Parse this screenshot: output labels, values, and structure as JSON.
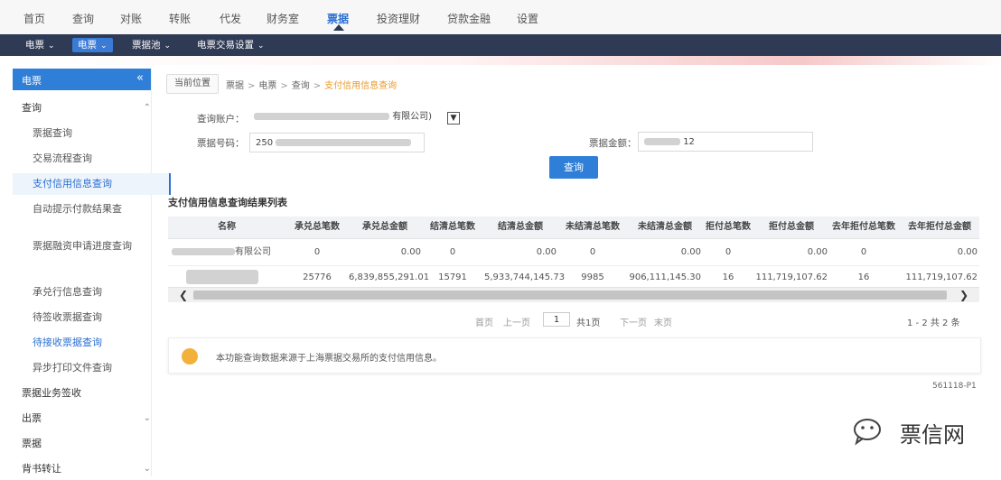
{
  "topnav": {
    "items": [
      "首页",
      "查询",
      "对账",
      "转账",
      "代发",
      "财务室",
      "票据",
      "投资理财",
      "贷款金融",
      "设置"
    ],
    "active_index": 6
  },
  "subnav": {
    "items": [
      "电票",
      "电票",
      "票据池",
      "电票交易设置"
    ],
    "active_index": 1
  },
  "sidebar": {
    "header": "电票",
    "collapse_icon": "«",
    "rows": [
      {
        "label": "查询",
        "type": "group",
        "arrow": "up"
      },
      {
        "label": "票据查询",
        "type": "child"
      },
      {
        "label": "交易流程查询",
        "type": "child"
      },
      {
        "label": "支付信用信息查询",
        "type": "child",
        "active": true
      },
      {
        "label": "自动提示付款结果查",
        "type": "child"
      },
      {
        "label": "票据融资申请进度查询",
        "type": "child"
      },
      {
        "label": "承兑行信息查询",
        "type": "child"
      },
      {
        "label": "待签收票据查询",
        "type": "child"
      },
      {
        "label": "待接收票据查询",
        "type": "child"
      },
      {
        "label": "异步打印文件查询",
        "type": "child"
      },
      {
        "label": "票据业务签收",
        "type": "group"
      },
      {
        "label": "出票",
        "type": "group",
        "arrow": "down"
      },
      {
        "label": "票据",
        "type": "group"
      },
      {
        "label": "背书转让",
        "type": "group",
        "arrow": "down"
      }
    ]
  },
  "breadcrumb": {
    "tab": "当前位置",
    "items": [
      "票据",
      "电票",
      "查询"
    ],
    "current": "支付信用信息查询"
  },
  "form": {
    "account_label": "查询账户：",
    "account_value": "有限公司)",
    "bill_no_label": "票据号码：",
    "bill_no_value": "250",
    "amount_label": "票据金额：",
    "amount_value": "12",
    "query_button": "查询"
  },
  "table": {
    "title": "支付信用信息查询结果列表",
    "headers": [
      "名称",
      "承兑总笔数",
      "承兑总金额",
      "结清总笔数",
      "结清总金额",
      "未结清总笔数",
      "未结清总金额",
      "拒付总笔数",
      "拒付总金额",
      "去年拒付总笔数",
      "去年拒付总金额"
    ],
    "rows": [
      [
        "有限公司",
        "0",
        "0.00",
        "0",
        "0.00",
        "0",
        "0.00",
        "0",
        "0.00",
        "0",
        "0.00"
      ],
      [
        "",
        "25776",
        "6,839,855,291.01",
        "15791",
        "5,933,744,145.73",
        "9985",
        "906,111,145.30",
        "16",
        "111,719,107.62",
        "16",
        "111,719,107.62"
      ]
    ]
  },
  "pagination": {
    "first": "首页",
    "prev": "上一页",
    "page": "1",
    "total_pages_text": "共1页",
    "next": "下一页",
    "last": "末页",
    "summary": "1 - 2   共 2 条"
  },
  "notice": {
    "text": "本功能查询数据来源于上海票据交易所的支付信用信息。"
  },
  "page_code": "561118-P1",
  "watermark": {
    "text": "票信网"
  },
  "colors": {
    "primary": "#2f7fd8",
    "nav_dark": "#2f3a55",
    "breadcrumb_current": "#e89a2c",
    "notice_icon": "#f2b13a"
  }
}
